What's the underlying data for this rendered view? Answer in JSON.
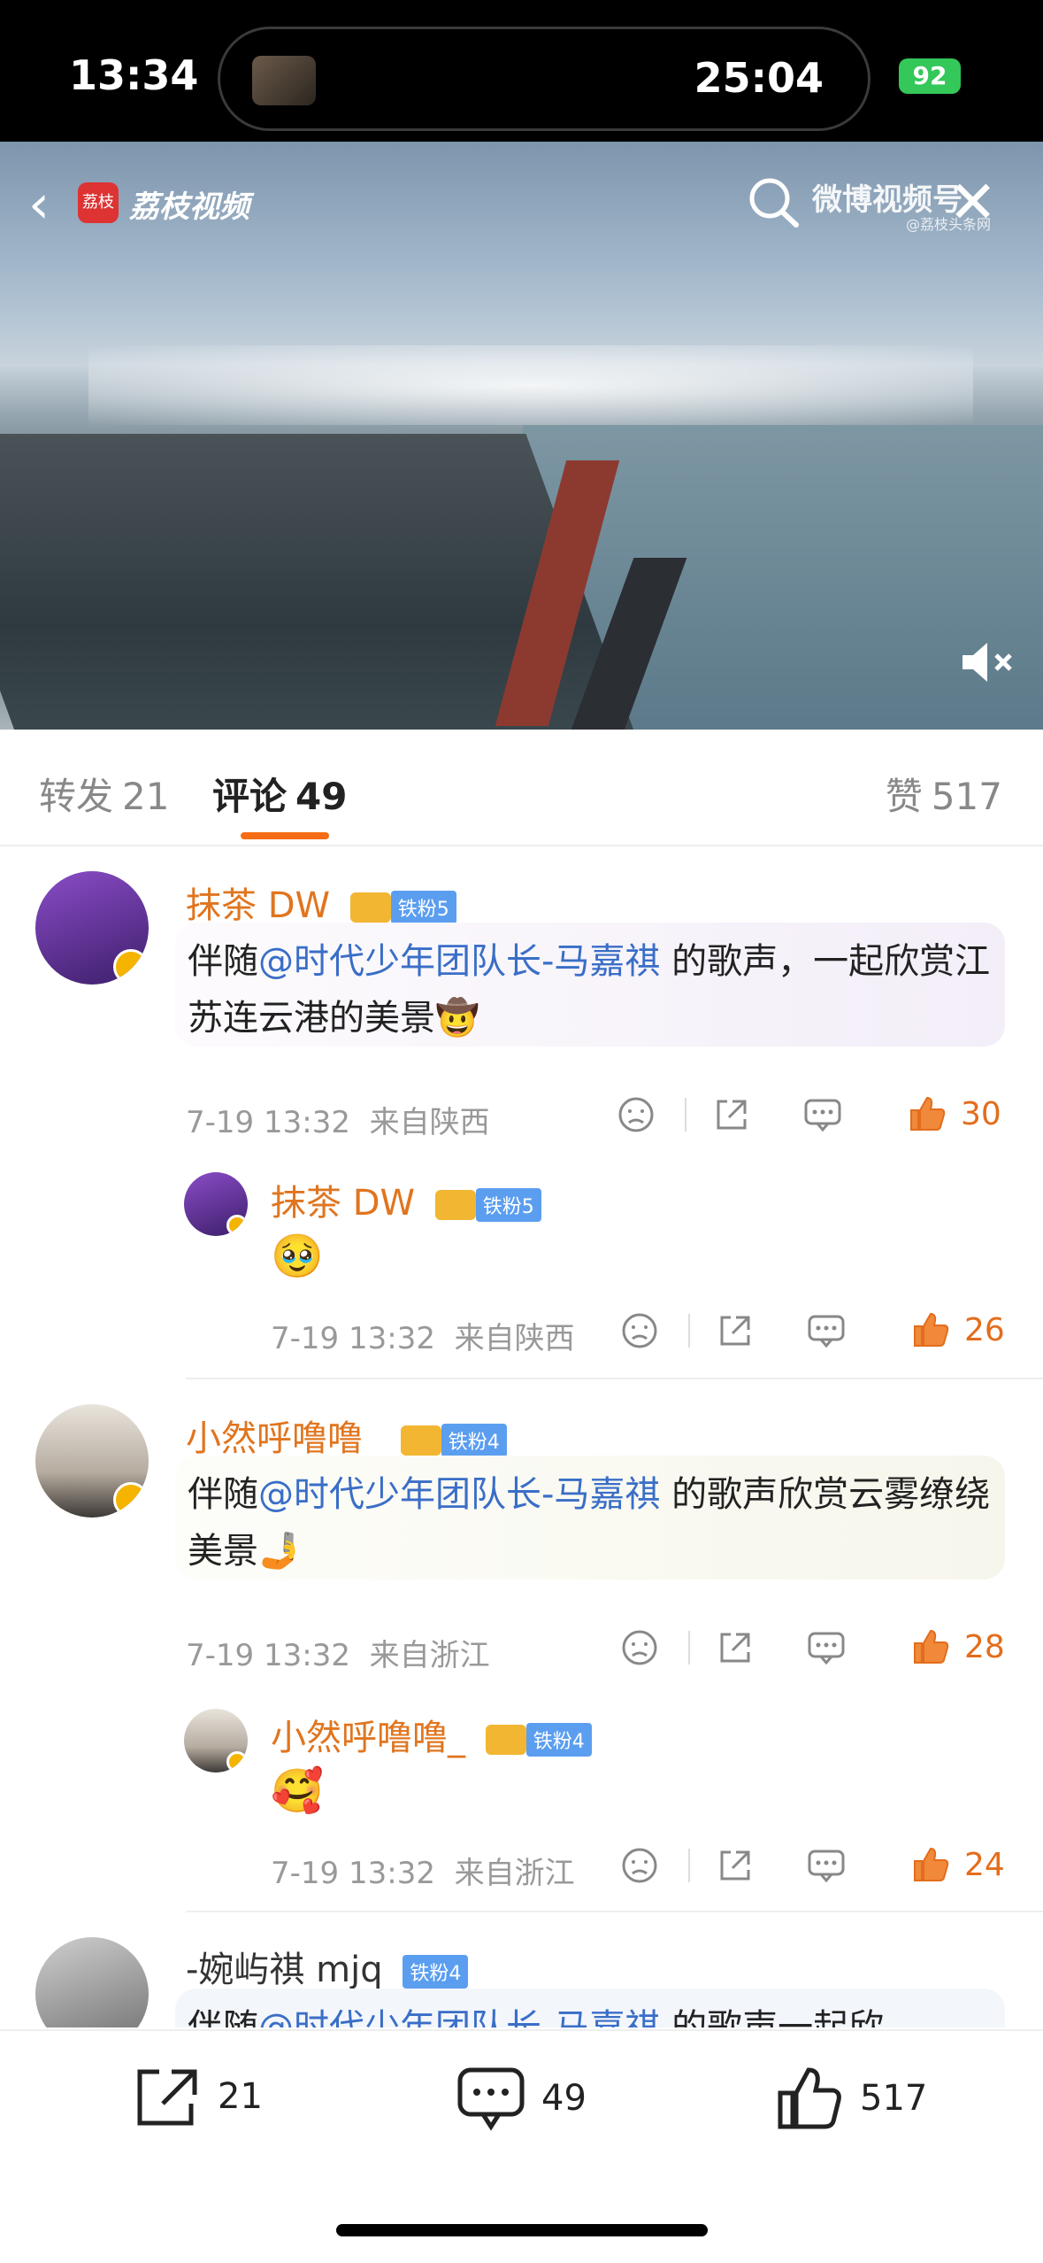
{
  "status": {
    "time": "13:34",
    "timer": "25:04",
    "battery": "92"
  },
  "video": {
    "brand_logo": "荔枝",
    "brand": "荔枝视频",
    "watermark": "微博视频号",
    "watermark_sub": "@荔枝头条网",
    "icons": [
      "back-icon",
      "search-icon",
      "close-icon",
      "mute-icon"
    ]
  },
  "tabs": {
    "repost_label": "转发",
    "repost_count": "21",
    "comment_label": "评论",
    "comment_count": "49",
    "like_label": "赞",
    "like_count": "517"
  },
  "comments": [
    {
      "user": "抹茶 DW",
      "fan_level": "铁粉5",
      "text_before": "伴随",
      "mention": "@时代少年团队长-马嘉祺",
      "text_after": " 的歌声，一起欣赏江苏连云港的美景",
      "emoji": "🤠",
      "time": "7-19 13:32",
      "location": "来自陕西",
      "likes": "30"
    },
    {
      "user": "抹茶 DW",
      "fan_level": "铁粉5",
      "emoji": "🥹",
      "time": "7-19 13:32",
      "location": "来自陕西",
      "likes": "26"
    },
    {
      "user": "小然呼噜噜_",
      "fan_level": "铁粉4",
      "text_before": "伴随",
      "mention": "@时代少年团队长-马嘉祺",
      "text_after": " 的歌声欣赏云雾缭绕美景",
      "emoji": "🤳",
      "time": "7-19 13:32",
      "location": "来自浙江",
      "likes": "28"
    },
    {
      "user": "小然呼噜噜_",
      "fan_level": "铁粉4",
      "emoji": "🥰",
      "time": "7-19 13:32",
      "location": "来自浙江",
      "likes": "24"
    },
    {
      "user": "-婉屿祺 mjq",
      "fan_level": "铁粉4",
      "text_before": "伴随",
      "mention": "@时代少年团队长-马嘉祺",
      "text_after": " 的歌声一起欣"
    }
  ],
  "bottom": {
    "repost": "21",
    "comment": "49",
    "like": "517"
  },
  "colors": {
    "accent": "#f56c15",
    "mention": "#3a6ec7",
    "username": "#e0751f"
  }
}
